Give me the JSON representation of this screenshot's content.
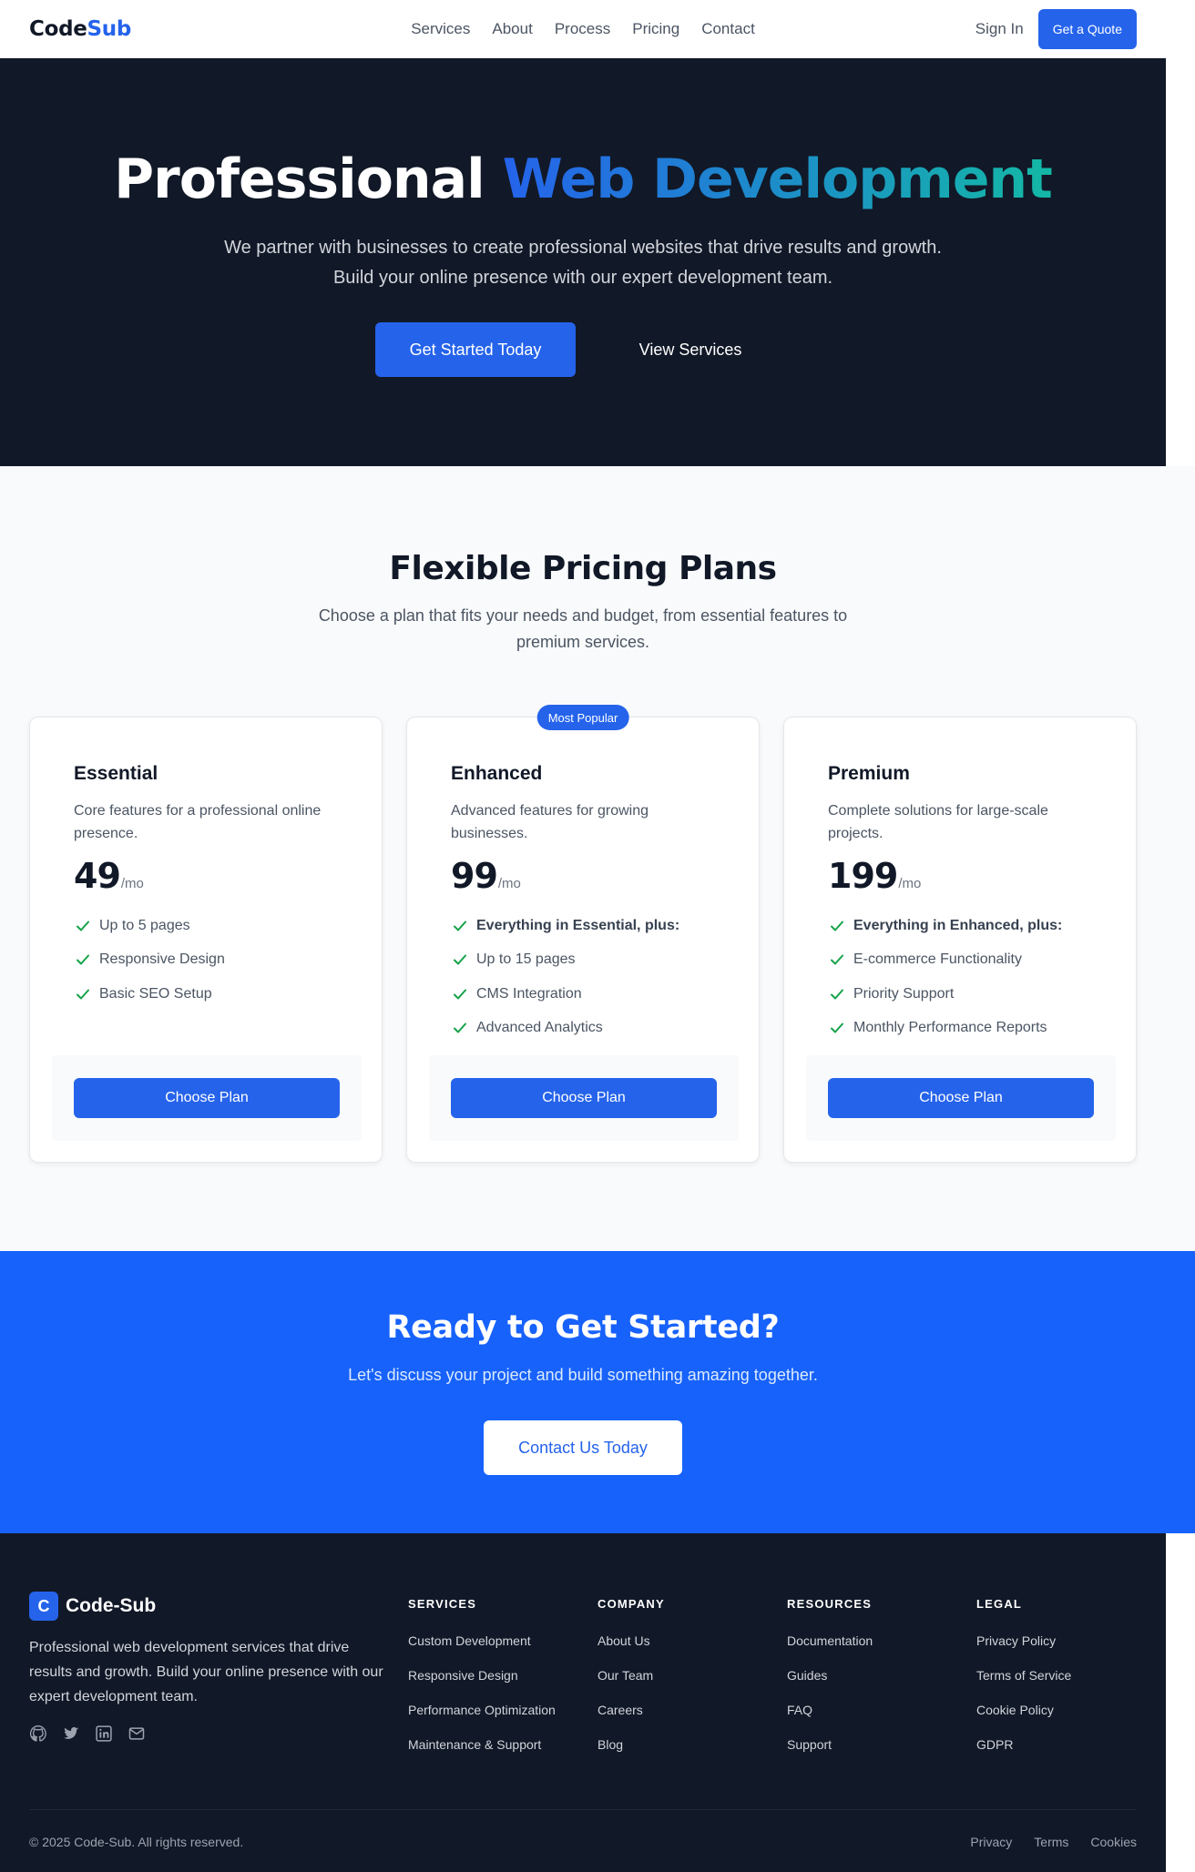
{
  "nav": {
    "logo_part1": "Code",
    "logo_part2": "Sub",
    "links": [
      "Services",
      "About",
      "Process",
      "Pricing",
      "Contact"
    ],
    "sign_in": "Sign In",
    "quote": "Get a Quote"
  },
  "hero": {
    "title_plain": "Professional",
    "title_highlight": "Web Development",
    "subtitle": "We partner with businesses to create professional websites that drive results and growth. Build your online presence with our expert development team.",
    "primary_cta": "Get Started Today",
    "secondary_cta": "View Services"
  },
  "pricing": {
    "title": "Flexible Pricing Plans",
    "subtitle": "Choose a plan that fits your needs and budget, from essential features to premium services.",
    "popular_badge": "Most Popular",
    "per": "/mo",
    "choose": "Choose Plan",
    "plans": [
      {
        "name": "Essential",
        "desc": "Core features for a professional online presence.",
        "price": "49",
        "features": [
          "Up to 5 pages",
          "Responsive Design",
          "Basic SEO Setup"
        ]
      },
      {
        "name": "Enhanced",
        "desc": "Advanced features for growing businesses.",
        "price": "99",
        "features": [
          "Everything in Essential, plus:",
          "Up to 15 pages",
          "CMS Integration",
          "Advanced Analytics"
        ]
      },
      {
        "name": "Premium",
        "desc": "Complete solutions for large-scale projects.",
        "price": "199",
        "features": [
          "Everything in Enhanced, plus:",
          "E-commerce Functionality",
          "Priority Support",
          "Monthly Performance Reports"
        ]
      }
    ]
  },
  "cta": {
    "title": "Ready to Get Started?",
    "subtitle": "Let's discuss your project and build something amazing together.",
    "button": "Contact Us Today"
  },
  "footer": {
    "logo_letter": "C",
    "brand": "Code-Sub",
    "desc": "Professional web development services that drive results and growth. Build your online presence with our expert development team.",
    "social_icons": [
      "github-icon",
      "twitter-icon",
      "linkedin-icon",
      "mail-icon"
    ],
    "columns": [
      {
        "title": "SERVICES",
        "items": [
          "Custom Development",
          "Responsive Design",
          "Performance Optimization",
          "Maintenance & Support"
        ]
      },
      {
        "title": "COMPANY",
        "items": [
          "About Us",
          "Our Team",
          "Careers",
          "Blog"
        ]
      },
      {
        "title": "RESOURCES",
        "items": [
          "Documentation",
          "Guides",
          "FAQ",
          "Support"
        ]
      },
      {
        "title": "LEGAL",
        "items": [
          "Privacy Policy",
          "Terms of Service",
          "Cookie Policy",
          "GDPR"
        ]
      }
    ],
    "copyright": "© 2025 Code-Sub. All rights reserved.",
    "legal_links": [
      "Privacy",
      "Terms",
      "Cookies"
    ]
  },
  "colors": {
    "accent": "#2563eb",
    "dark": "#111827",
    "cta_bg": "#1762fb",
    "check": "#16a34a",
    "gradient_end": "#14b8a6"
  }
}
